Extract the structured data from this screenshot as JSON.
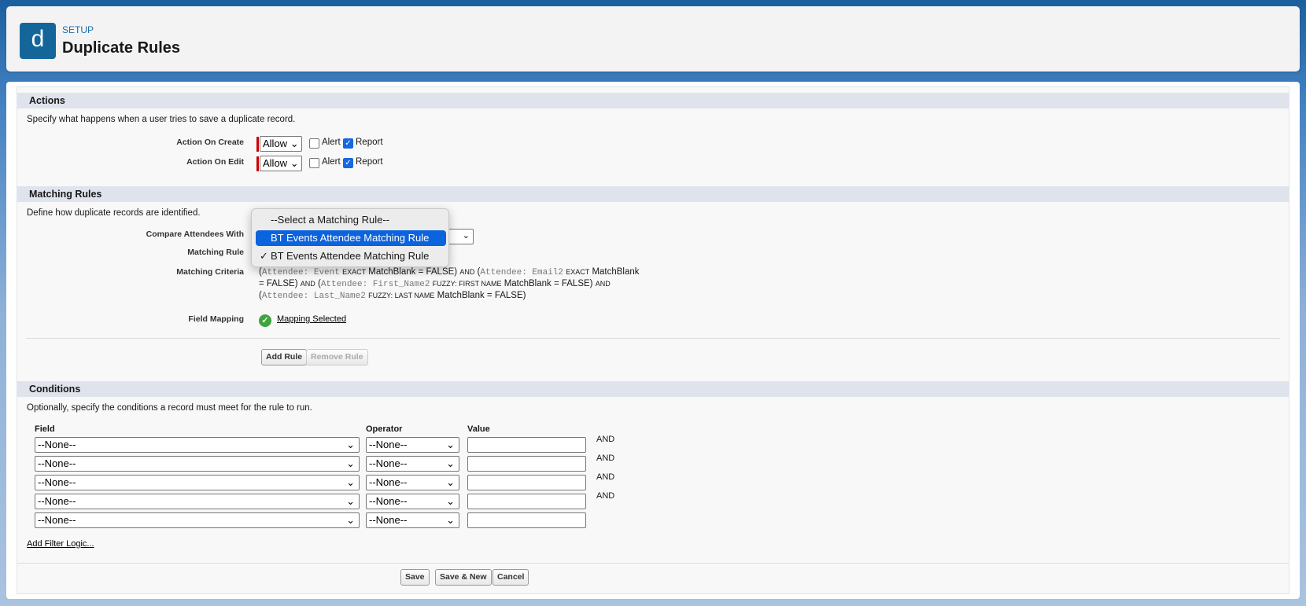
{
  "header": {
    "icon_letter": "d",
    "breadcrumb": "SETUP",
    "title": "Duplicate Rules"
  },
  "actions": {
    "heading": "Actions",
    "description": "Specify what happens when a user tries to save a duplicate record.",
    "rows": [
      {
        "label": "Action On Create",
        "value": "Allow",
        "alert_label": "Alert",
        "alert_checked": false,
        "report_label": "Report",
        "report_checked": true
      },
      {
        "label": "Action On Edit",
        "value": "Allow",
        "alert_label": "Alert",
        "alert_checked": false,
        "report_label": "Report",
        "report_checked": true
      }
    ]
  },
  "matching": {
    "heading": "Matching Rules",
    "description": "Define how duplicate records are identified.",
    "compare_label": "Compare Attendees With",
    "rule_label": "Matching Rule",
    "criteria_label": "Matching Criteria",
    "mapping_label": "Field Mapping",
    "criteria": {
      "p1": "(",
      "f1": "Attendee: Event",
      "o1": "EXACT",
      "m1": "MatchBlank = FALSE)",
      "and1": "AND",
      "p2": "(",
      "f2": "Attendee: Email2",
      "o2": "EXACT",
      "m2": "MatchBlank = FALSE)",
      "and2": "AND",
      "p3": "(",
      "f3": "Attendee: First_Name2",
      "o3": "FUZZY: FIRST NAME",
      "m3": "MatchBlank = FALSE)",
      "and3": "AND",
      "p4": "(",
      "f4": "Attendee: Last_Name2",
      "o4": "FUZZY: LAST NAME",
      "m4": "MatchBlank = FALSE)"
    },
    "mapping_link": "Mapping Selected",
    "add_rule": "Add Rule",
    "remove_rule": "Remove Rule",
    "dropdown": {
      "options": [
        "--Select a Matching Rule--",
        "BT Events Attendee Matching Rule",
        "BT Events Attendee Matching Rule"
      ],
      "highlighted_index": 1,
      "checked_index": 2,
      "check_mark": "✓"
    }
  },
  "conditions": {
    "heading": "Conditions",
    "description": "Optionally, specify the conditions a record must meet for the rule to run.",
    "col_field": "Field",
    "col_operator": "Operator",
    "col_value": "Value",
    "rows": [
      {
        "field": "--None--",
        "operator": "--None--",
        "value": "",
        "conj": "AND"
      },
      {
        "field": "--None--",
        "operator": "--None--",
        "value": "",
        "conj": "AND"
      },
      {
        "field": "--None--",
        "operator": "--None--",
        "value": "",
        "conj": "AND"
      },
      {
        "field": "--None--",
        "operator": "--None--",
        "value": "",
        "conj": "AND"
      },
      {
        "field": "--None--",
        "operator": "--None--",
        "value": "",
        "conj": ""
      }
    ],
    "filter_logic_link": "Add Filter Logic..."
  },
  "footer": {
    "save": "Save",
    "save_new": "Save & New",
    "cancel": "Cancel"
  },
  "colors": {
    "accent": "#14669a",
    "highlight": "#0b63dd",
    "required": "#cc0000"
  }
}
